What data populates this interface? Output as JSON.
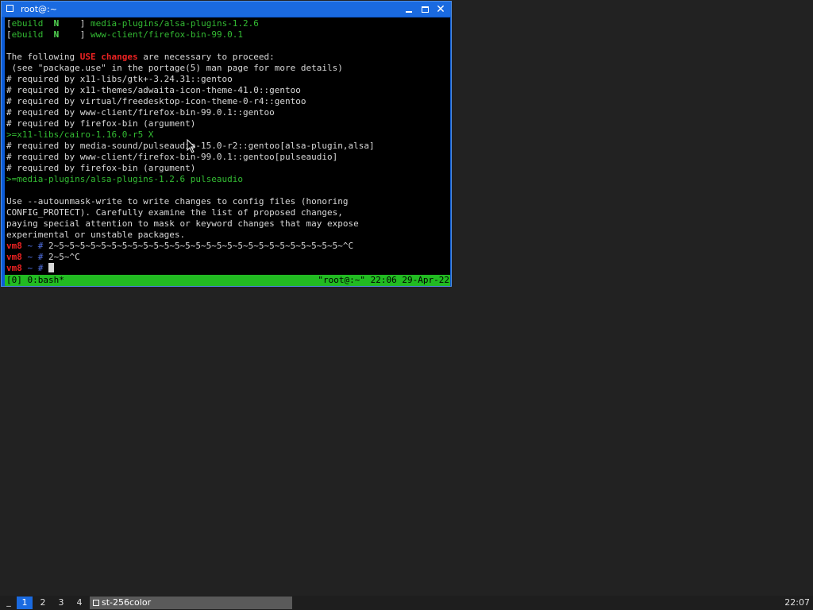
{
  "window": {
    "title": "root@:~"
  },
  "terminal": {
    "lines": [
      [
        {
          "t": "[",
          "c": "c-white"
        },
        {
          "t": "ebuild",
          "c": "c-green"
        },
        {
          "t": "  ",
          "c": "c-white"
        },
        {
          "t": "N",
          "c": "c-bgreen"
        },
        {
          "t": "    ] ",
          "c": "c-white"
        },
        {
          "t": "media-plugins/alsa-plugins-1.2.6",
          "c": "c-green"
        }
      ],
      [
        {
          "t": "[",
          "c": "c-white"
        },
        {
          "t": "ebuild",
          "c": "c-green"
        },
        {
          "t": "  ",
          "c": "c-white"
        },
        {
          "t": "N",
          "c": "c-bgreen"
        },
        {
          "t": "    ] ",
          "c": "c-white"
        },
        {
          "t": "www-client/firefox-bin-99.0.1",
          "c": "c-green"
        }
      ],
      [
        {
          "t": "",
          "c": "c-white"
        }
      ],
      [
        {
          "t": "The following ",
          "c": "c-white"
        },
        {
          "t": "USE changes",
          "c": "c-bred"
        },
        {
          "t": " are necessary to proceed:",
          "c": "c-white"
        }
      ],
      [
        {
          "t": " (see \"package.use\" in the portage(5) man page for more details)",
          "c": "c-white"
        }
      ],
      [
        {
          "t": "# required by x11-libs/gtk+-3.24.31::gentoo",
          "c": "c-white"
        }
      ],
      [
        {
          "t": "# required by x11-themes/adwaita-icon-theme-41.0::gentoo",
          "c": "c-white"
        }
      ],
      [
        {
          "t": "# required by virtual/freedesktop-icon-theme-0-r4::gentoo",
          "c": "c-white"
        }
      ],
      [
        {
          "t": "# required by www-client/firefox-bin-99.0.1::gentoo",
          "c": "c-white"
        }
      ],
      [
        {
          "t": "# required by firefox-bin (argument)",
          "c": "c-white"
        }
      ],
      [
        {
          "t": ">=x11-libs/cairo-1.16.0-r5 X",
          "c": "c-green"
        }
      ],
      [
        {
          "t": "# required by media-sound/pulseaudio-15.0-r2::gentoo[alsa-plugin,alsa]",
          "c": "c-white"
        }
      ],
      [
        {
          "t": "# required by www-client/firefox-bin-99.0.1::gentoo[pulseaudio]",
          "c": "c-white"
        }
      ],
      [
        {
          "t": "# required by firefox-bin (argument)",
          "c": "c-white"
        }
      ],
      [
        {
          "t": ">=media-plugins/alsa-plugins-1.2.6 pulseaudio",
          "c": "c-green"
        }
      ],
      [
        {
          "t": "",
          "c": "c-white"
        }
      ],
      [
        {
          "t": "Use --autounmask-write to write changes to config files (honoring",
          "c": "c-white"
        }
      ],
      [
        {
          "t": "CONFIG_PROTECT). Carefully examine the list of proposed changes,",
          "c": "c-white"
        }
      ],
      [
        {
          "t": "paying special attention to mask or keyword changes that may expose",
          "c": "c-white"
        }
      ],
      [
        {
          "t": "experimental or unstable packages.",
          "c": "c-white"
        }
      ],
      [
        {
          "t": "vm8",
          "c": "c-bred"
        },
        {
          "t": " ~ ",
          "c": "c-blue"
        },
        {
          "t": "# ",
          "c": "c-blue"
        },
        {
          "t": "2~5~5~5~5~5~5~5~5~5~5~5~5~5~5~5~5~5~5~5~5~5~5~5~5~5~5~5~^C",
          "c": "c-white"
        }
      ],
      [
        {
          "t": "vm8",
          "c": "c-bred"
        },
        {
          "t": " ~ ",
          "c": "c-blue"
        },
        {
          "t": "# ",
          "c": "c-blue"
        },
        {
          "t": "2~5~^C",
          "c": "c-white"
        }
      ],
      [
        {
          "t": "vm8",
          "c": "c-bred"
        },
        {
          "t": " ~ ",
          "c": "c-blue"
        },
        {
          "t": "# ",
          "c": "c-blue"
        }
      ]
    ],
    "tmux": {
      "left": "[0] 0:bash*",
      "right": "\"root@:~\" 22:06 29-Apr-22"
    }
  },
  "panel": {
    "menu_label": "_",
    "workspaces": [
      "1",
      "2",
      "3",
      "4"
    ],
    "active_workspace": "1",
    "task_label": "st-256color",
    "clock": "22:07"
  },
  "colors": {
    "titlebar": "#1a6ae0",
    "tmux_bar": "#22bb22",
    "desktop": "#222222"
  }
}
